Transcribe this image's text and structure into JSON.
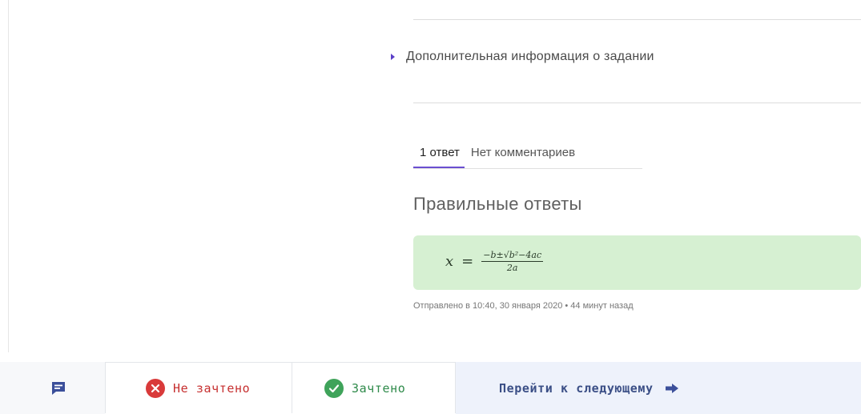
{
  "task_info": {
    "label": "Дополнительная информация о задании"
  },
  "tabs": [
    {
      "label": "1 ответ"
    },
    {
      "label": "Нет комментариев"
    }
  ],
  "answers": {
    "title": "Правильные ответы",
    "formula": {
      "lhs": "x",
      "eq": "=",
      "numerator": "−b±√b²−4ac",
      "denominator": "2a"
    },
    "sent_info": "Отправлено в 10:40, 30 января 2020 • 44 минут назад"
  },
  "bottom_bar": {
    "fail_label": "Не зачтено",
    "pass_label": "Зачтено",
    "next_label": "Перейти к следующему"
  },
  "colors": {
    "accent": "#6a4fd0",
    "answer_bg": "#d6f0d2",
    "fail": "#d93a3a",
    "pass": "#3fa35a",
    "next_bg": "#eef2fb",
    "chat_icon": "#3b4f9a"
  },
  "icons": {
    "chat": "chat-icon",
    "fail": "x-circle-icon",
    "pass": "check-circle-icon",
    "next": "arrow-right-icon",
    "expand": "triangle-right-icon"
  }
}
